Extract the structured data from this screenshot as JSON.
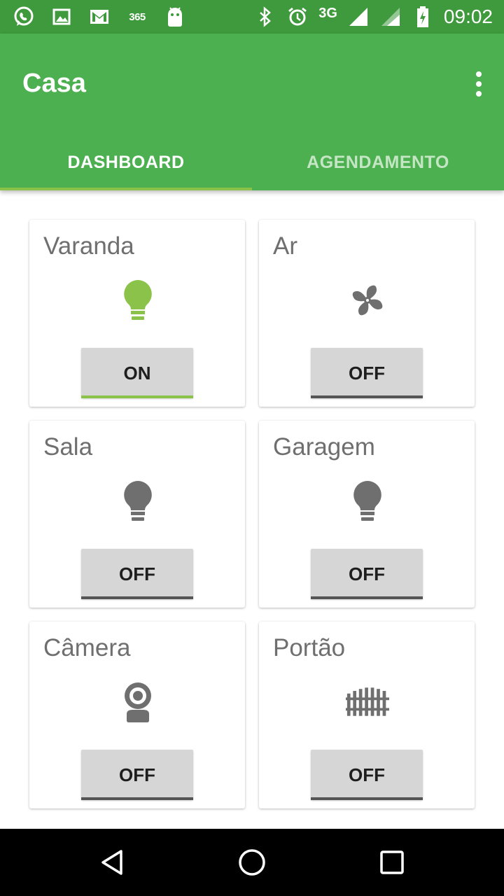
{
  "status_bar": {
    "left_icons": [
      "whatsapp-icon",
      "gallery-icon",
      "gmail-icon",
      "office365-icon",
      "android-icon"
    ],
    "label_365": "365",
    "network": "3G",
    "time": "09:02"
  },
  "app_bar": {
    "title": "Casa",
    "background": "#4caf50"
  },
  "tabs": [
    {
      "label": "DASHBOARD",
      "selected": true
    },
    {
      "label": "AGENDAMENTO",
      "selected": false
    }
  ],
  "devices": [
    {
      "name": "Varanda",
      "icon": "lightbulb-icon",
      "state": "ON",
      "active": true
    },
    {
      "name": "Ar",
      "icon": "fan-icon",
      "state": "OFF",
      "active": false
    },
    {
      "name": "Sala",
      "icon": "lightbulb-icon",
      "state": "OFF",
      "active": false
    },
    {
      "name": "Garagem",
      "icon": "lightbulb-icon",
      "state": "OFF",
      "active": false
    },
    {
      "name": "Câmera",
      "icon": "webcam-icon",
      "state": "OFF",
      "active": false
    },
    {
      "name": "Portão",
      "icon": "gate-icon",
      "state": "OFF",
      "active": false
    }
  ],
  "colors": {
    "status_bar": "#3e9a3c",
    "accent": "#8bc34a",
    "icon_active": "#8bc34a",
    "icon_inactive": "#6f6f6f"
  },
  "nav_bar": {
    "buttons": [
      "back-icon",
      "home-icon",
      "recents-icon"
    ]
  }
}
